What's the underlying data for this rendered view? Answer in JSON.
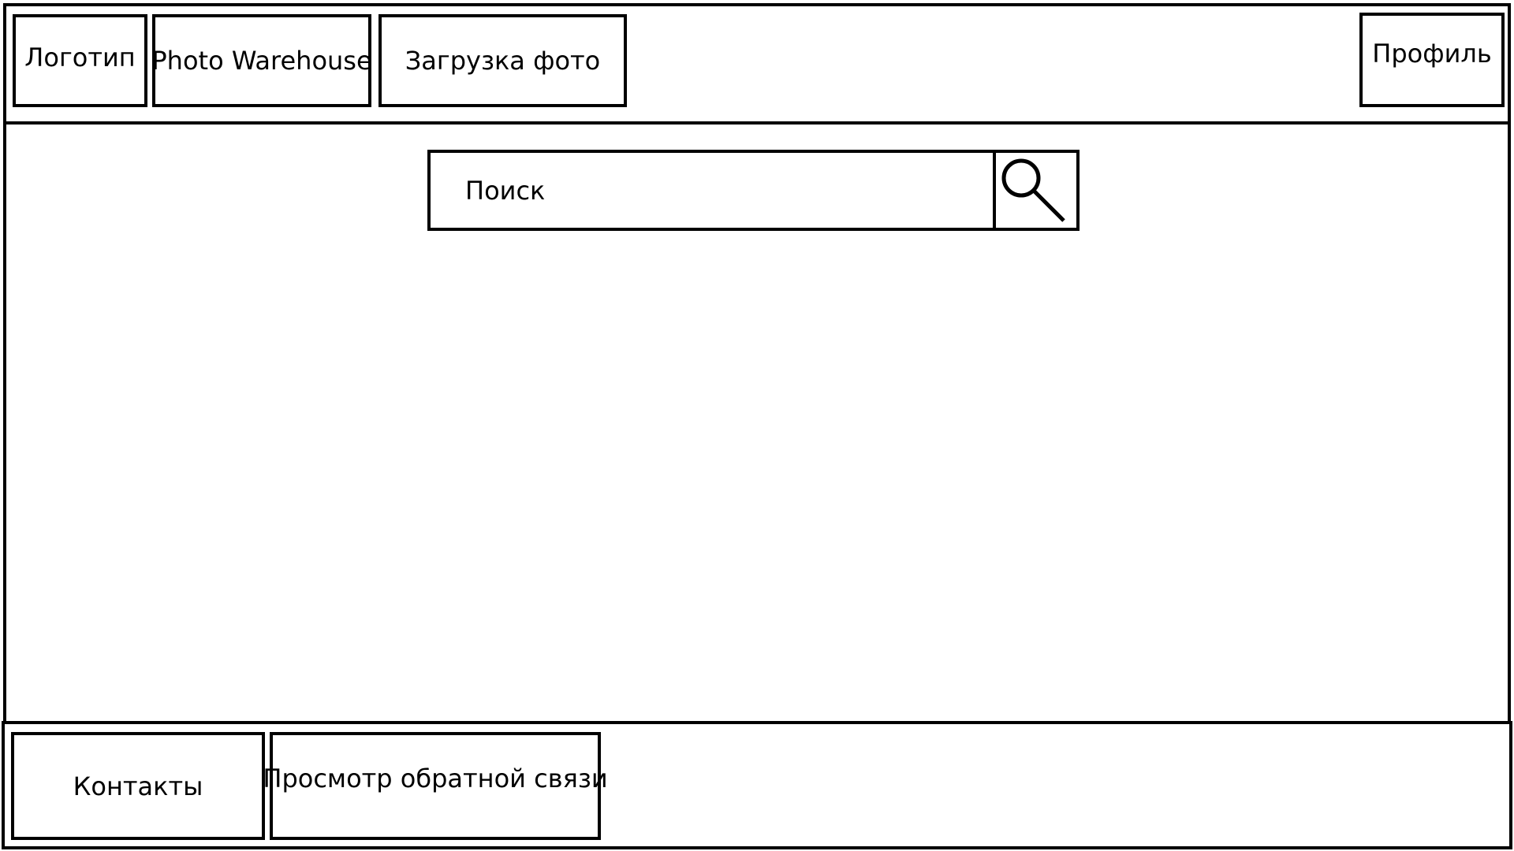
{
  "header": {
    "logo_label": "Логотип",
    "brand_label": "Photo Warehouse",
    "upload_label": "Загрузка фото",
    "profile_label": "Профиль"
  },
  "main": {
    "search": {
      "placeholder": "Поиск",
      "button_icon": "search-icon"
    }
  },
  "footer": {
    "contacts_label": "Контакты",
    "feedback_label": "Просмотр обратной связи"
  },
  "colors": {
    "border": "#000000",
    "background": "#ffffff"
  }
}
